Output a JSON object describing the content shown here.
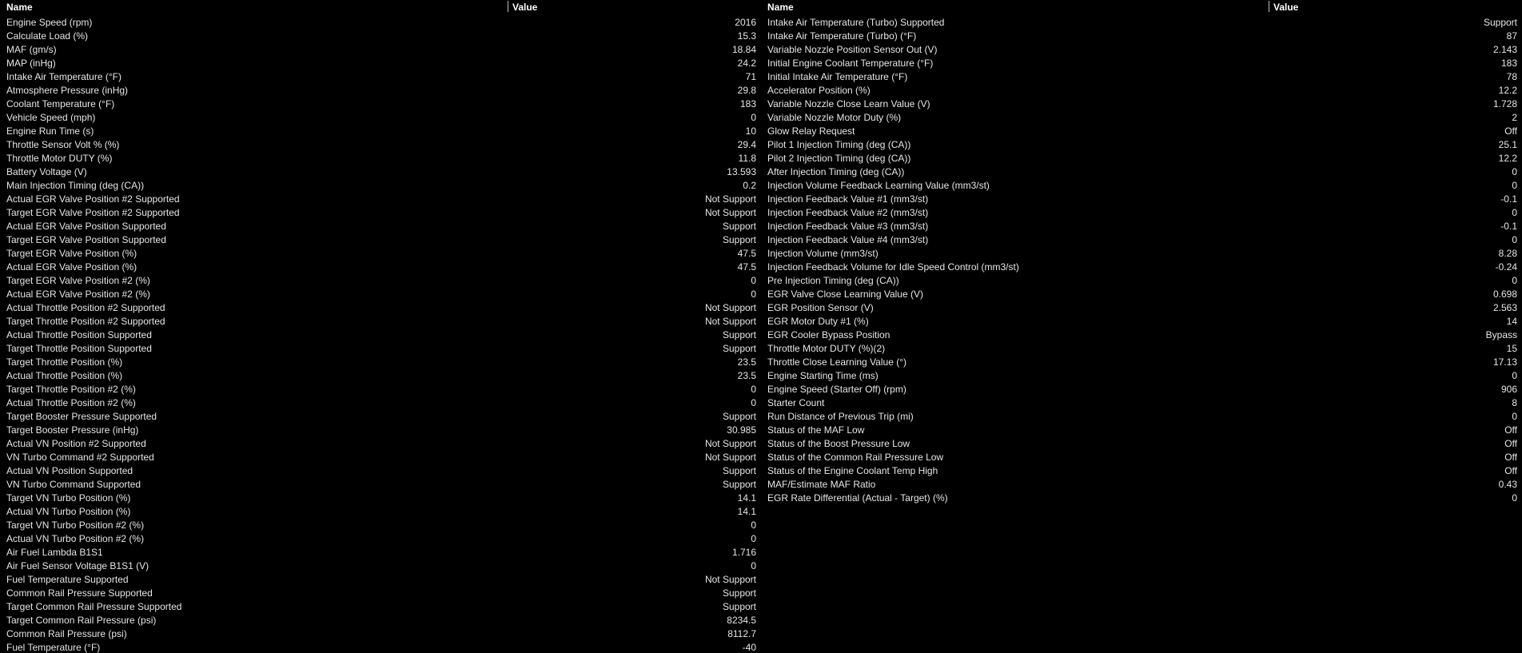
{
  "header": {
    "name_label": "Name",
    "value_label": "Value"
  },
  "colors": {
    "background": "#000000",
    "text": "#e6e6e6",
    "header_text": "#ffffff",
    "divider": "#bfbfbf"
  },
  "left_rows": [
    {
      "name": "Engine Speed (rpm)",
      "value": "2016"
    },
    {
      "name": "Calculate Load (%)",
      "value": "15.3"
    },
    {
      "name": "MAF (gm/s)",
      "value": "18.84"
    },
    {
      "name": "MAP (inHg)",
      "value": "24.2"
    },
    {
      "name": "Intake Air Temperature (°F)",
      "value": "71"
    },
    {
      "name": "Atmosphere Pressure (inHg)",
      "value": "29.8"
    },
    {
      "name": "Coolant Temperature (°F)",
      "value": "183"
    },
    {
      "name": "Vehicle Speed (mph)",
      "value": "0"
    },
    {
      "name": "Engine Run Time (s)",
      "value": "10"
    },
    {
      "name": "Throttle Sensor Volt % (%)",
      "value": "29.4"
    },
    {
      "name": "Throttle Motor DUTY (%)",
      "value": "11.8"
    },
    {
      "name": "Battery Voltage (V)",
      "value": "13.593"
    },
    {
      "name": "Main Injection Timing (deg (CA))",
      "value": "0.2"
    },
    {
      "name": "Actual EGR Valve Position #2 Supported",
      "value": "Not Support"
    },
    {
      "name": "Target EGR Valve Position #2 Supported",
      "value": "Not Support"
    },
    {
      "name": "Actual EGR Valve Position Supported",
      "value": "Support"
    },
    {
      "name": "Target EGR Valve Position Supported",
      "value": "Support"
    },
    {
      "name": "Target EGR Valve Position (%)",
      "value": "47.5"
    },
    {
      "name": "Actual EGR Valve Position (%)",
      "value": "47.5"
    },
    {
      "name": "Target EGR Valve Position #2 (%)",
      "value": "0"
    },
    {
      "name": "Actual EGR Valve Position #2 (%)",
      "value": "0"
    },
    {
      "name": "Actual Throttle Position #2 Supported",
      "value": "Not Support"
    },
    {
      "name": "Target Throttle Position #2 Supported",
      "value": "Not Support"
    },
    {
      "name": "Actual Throttle Position Supported",
      "value": "Support"
    },
    {
      "name": "Target Throttle Position Supported",
      "value": "Support"
    },
    {
      "name": "Target Throttle Position (%)",
      "value": "23.5"
    },
    {
      "name": "Actual Throttle Position (%)",
      "value": "23.5"
    },
    {
      "name": "Target Throttle Position #2 (%)",
      "value": "0"
    },
    {
      "name": "Actual Throttle Position #2 (%)",
      "value": "0"
    },
    {
      "name": "Target Booster Pressure Supported",
      "value": "Support"
    },
    {
      "name": "Target Booster Pressure (inHg)",
      "value": "30.985"
    },
    {
      "name": "Actual VN Position #2 Supported",
      "value": "Not Support"
    },
    {
      "name": "VN Turbo Command #2 Supported",
      "value": "Not Support"
    },
    {
      "name": "Actual VN Position Supported",
      "value": "Support"
    },
    {
      "name": "VN Turbo Command Supported",
      "value": "Support"
    },
    {
      "name": "Target VN Turbo Position (%)",
      "value": "14.1"
    },
    {
      "name": "Actual VN Turbo Position (%)",
      "value": "14.1"
    },
    {
      "name": "Target VN Turbo Position #2 (%)",
      "value": "0"
    },
    {
      "name": "Actual VN Turbo Position #2 (%)",
      "value": "0"
    },
    {
      "name": "Air Fuel Lambda B1S1",
      "value": "1.716"
    },
    {
      "name": "Air Fuel Sensor Voltage B1S1 (V)",
      "value": "0"
    },
    {
      "name": "Fuel Temperature Supported",
      "value": "Not Support"
    },
    {
      "name": "Common Rail Pressure Supported",
      "value": "Support"
    },
    {
      "name": "Target Common Rail Pressure Supported",
      "value": "Support"
    },
    {
      "name": "Target Common Rail Pressure (psi)",
      "value": "8234.5"
    },
    {
      "name": "Common Rail Pressure (psi)",
      "value": "8112.7"
    },
    {
      "name": "Fuel Temperature (°F)",
      "value": "-40"
    }
  ],
  "right_rows": [
    {
      "name": "Intake Air Temperature (Turbo) Supported",
      "value": "Support"
    },
    {
      "name": "Intake Air Temperature (Turbo) (°F)",
      "value": "87"
    },
    {
      "name": "Variable Nozzle Position Sensor Out (V)",
      "value": "2.143"
    },
    {
      "name": "Initial Engine Coolant Temperature (°F)",
      "value": "183"
    },
    {
      "name": "Initial Intake Air Temperature (°F)",
      "value": "78"
    },
    {
      "name": "Accelerator Position (%)",
      "value": "12.2"
    },
    {
      "name": "Variable Nozzle Close Learn Value (V)",
      "value": "1.728"
    },
    {
      "name": "Variable Nozzle Motor Duty (%)",
      "value": "2"
    },
    {
      "name": "Glow Relay Request",
      "value": "Off"
    },
    {
      "name": "Pilot 1 Injection Timing (deg (CA))",
      "value": "25.1"
    },
    {
      "name": "Pilot 2 Injection Timing (deg (CA))",
      "value": "12.2"
    },
    {
      "name": "After Injection Timing (deg (CA))",
      "value": "0"
    },
    {
      "name": "Injection Volume Feedback Learning Value (mm3/st)",
      "value": "0"
    },
    {
      "name": "Injection Feedback Value #1 (mm3/st)",
      "value": "-0.1"
    },
    {
      "name": "Injection Feedback Value #2 (mm3/st)",
      "value": "0"
    },
    {
      "name": "Injection Feedback Value #3 (mm3/st)",
      "value": "-0.1"
    },
    {
      "name": "Injection Feedback Value #4 (mm3/st)",
      "value": "0"
    },
    {
      "name": "Injection Volume (mm3/st)",
      "value": "8.28"
    },
    {
      "name": "Injection Feedback Volume for Idle Speed Control (mm3/st)",
      "value": "-0.24"
    },
    {
      "name": "Pre Injection Timing (deg (CA))",
      "value": "0"
    },
    {
      "name": "EGR Valve Close Learning Value (V)",
      "value": "0.698"
    },
    {
      "name": "EGR Position Sensor  (V)",
      "value": "2.563"
    },
    {
      "name": "EGR Motor Duty #1 (%)",
      "value": "14"
    },
    {
      "name": "EGR Cooler Bypass Position",
      "value": "Bypass"
    },
    {
      "name": "Throttle Motor DUTY (%)(2)",
      "value": "15"
    },
    {
      "name": "Throttle Close Learning Value (°)",
      "value": "17.13"
    },
    {
      "name": "Engine Starting Time (ms)",
      "value": "0"
    },
    {
      "name": "Engine Speed (Starter Off) (rpm)",
      "value": "906"
    },
    {
      "name": "Starter Count",
      "value": "8"
    },
    {
      "name": "Run Distance of Previous Trip (mi)",
      "value": "0"
    },
    {
      "name": "Status of the MAF Low",
      "value": "Off"
    },
    {
      "name": "Status of the Boost Pressure Low",
      "value": "Off"
    },
    {
      "name": "Status of the Common Rail Pressure Low",
      "value": "Off"
    },
    {
      "name": "Status of the Engine Coolant Temp High",
      "value": "Off"
    },
    {
      "name": "MAF/Estimate MAF Ratio",
      "value": "0.43"
    },
    {
      "name": "EGR Rate Differential (Actual - Target) (%)",
      "value": "0"
    }
  ]
}
